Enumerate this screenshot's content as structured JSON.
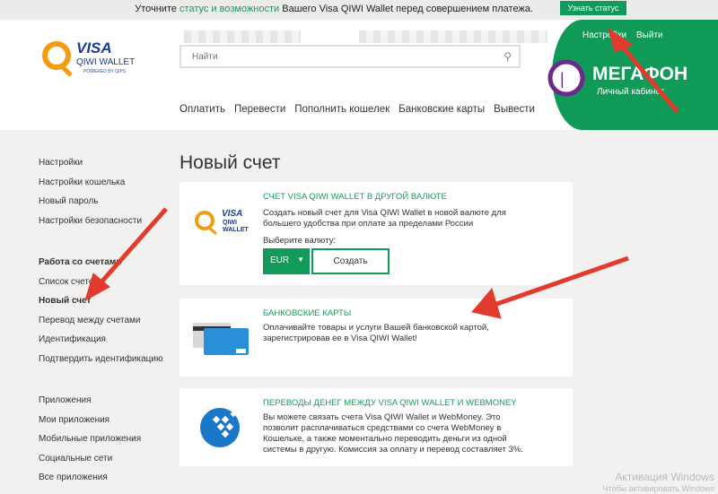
{
  "banner": {
    "text_before": "Уточните ",
    "link": "статус и возможности",
    "text_after": " Вашего Visa QIWI Wallet перед совершением платежа.",
    "button": "Узнать статус"
  },
  "header": {
    "settings": "Настройки",
    "logout": "Выйти",
    "search_placeholder": "Найти",
    "nav": [
      "Оплатить",
      "Перевести",
      "Пополнить кошелек",
      "Банковские карты",
      "Вывести"
    ],
    "logo": {
      "visa": "VISA",
      "qiwi": "QIWI WALLET",
      "powered": "POWERED BY QIPS"
    },
    "megafon": {
      "name": "МегаФон",
      "cabinet": "Личный кабинет"
    }
  },
  "sidebar": {
    "group1": [
      "Настройки",
      "Настройки кошелька",
      "Новый пароль",
      "Настройки безопасности"
    ],
    "group2_title": "Работа со счетами",
    "group2": [
      "Список счетов",
      "Новый счет",
      "Перевод между счетами",
      "Идентификация",
      "Подтвердить идентификацию"
    ],
    "group3": [
      "Приложения",
      "Мои приложения",
      "Мобильные приложения",
      "Социальные сети",
      "Все приложения"
    ]
  },
  "main": {
    "title": "Новый счет",
    "card1": {
      "title": "СЧЕТ VISA QIWI WALLET В ДРУГОЙ ВАЛЮТЕ",
      "text": "Создать новый счет для Visa QIWI Wallet в новой валюте для большего удобства при оплате за пределами России",
      "choose": "Выберите валюту:",
      "currency": "EUR",
      "create": "Создать",
      "logo_visa": "VISA",
      "logo_qiwi": "QIWI",
      "logo_wallet": "WALLET"
    },
    "card2": {
      "title": "БАНКОВСКИЕ КАРТЫ",
      "text": "Оплачивайте товары и услуги Вашей банковской картой, зарегистрировав ее в Visa QIWI Wallet!"
    },
    "card3": {
      "title": "ПЕРЕВОДЫ ДЕНЕГ МЕЖДУ VISA QIWI WALLET И WEBMONEY",
      "text": "Вы можете связать счета Visa QIWI Wallet и WebMoney. Это позволит расплачиваться средствами со счета WebMoney в Кошельке, а также моментально переводить деньги из одной системы в другую. Комиссия за оплату и перевод составляет 3%."
    }
  },
  "watermark": {
    "line1": "Активация Windows",
    "line2": "Чтобы активировать Windows"
  }
}
